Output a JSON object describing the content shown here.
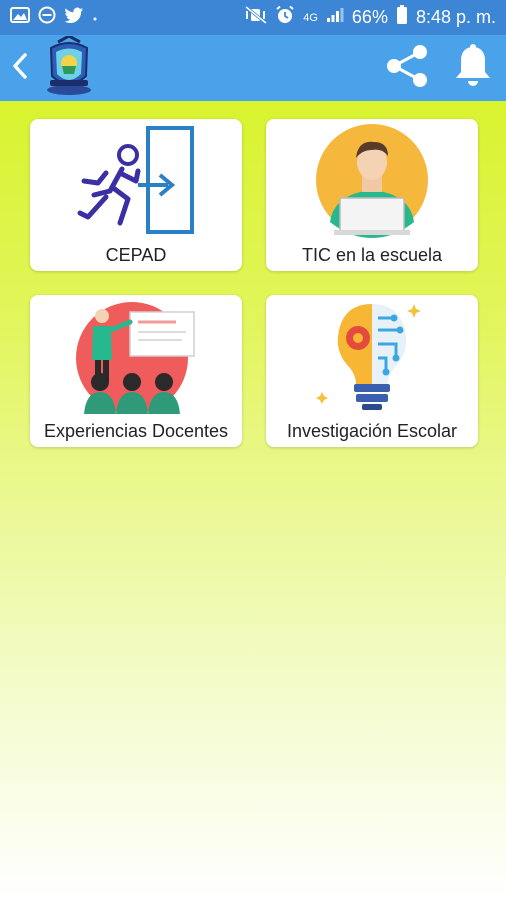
{
  "status_bar": {
    "battery_percent": "66%",
    "time": "8:48 p. m.",
    "network": "4G"
  },
  "app_bar": {
    "back_icon": "chevron-left-icon",
    "logo": "school-crest-logo",
    "share_icon": "share-icon",
    "bell_icon": "bell-icon"
  },
  "cards": [
    {
      "label": "CEPAD",
      "icon": "exit-running-icon"
    },
    {
      "label": "TIC en la escuela",
      "icon": "teacher-laptop-icon"
    },
    {
      "label": "Experiencias Docentes",
      "icon": "presentation-icon"
    },
    {
      "label": "Investigación Escolar",
      "icon": "lightbulb-circuit-icon"
    }
  ],
  "colors": {
    "status_bar": "#3d86d6",
    "app_bar": "#4aa3ea",
    "background_top": "#d4f21a",
    "background_bottom": "#ffffff"
  }
}
